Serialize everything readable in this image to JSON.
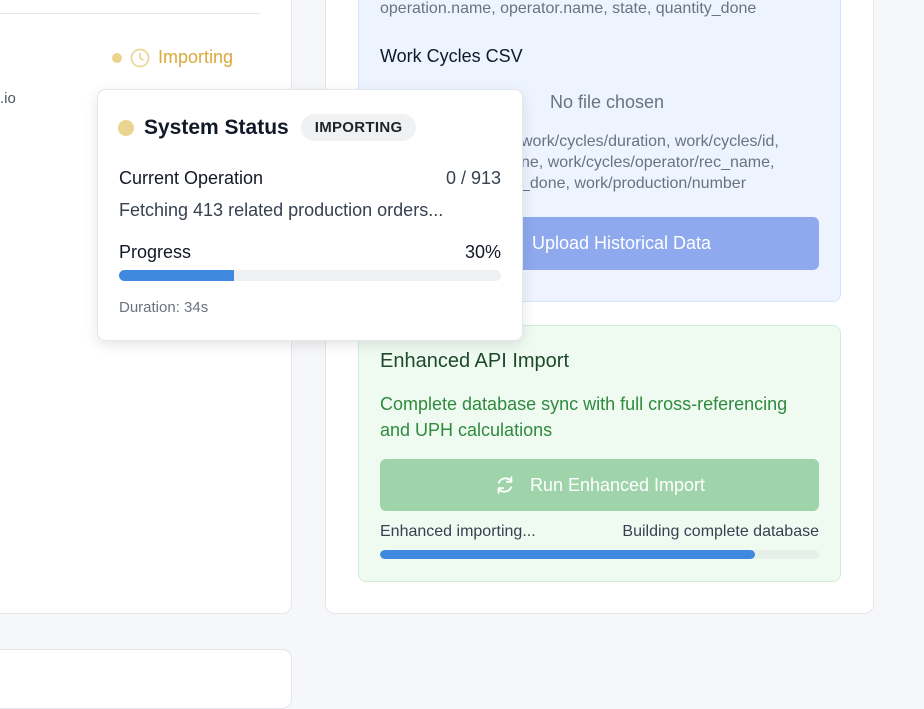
{
  "left_card": {
    "status_label": "Importing",
    "snippet": ".io"
  },
  "blue_panel": {
    "fields_line": "operation.name, operator.name, state, quantity_done",
    "work_cycles_title": "Work Cycles CSV",
    "file_chosen": "No file chosen",
    "wc_fields_1": "work/cycles/duration, work/cycles/id,",
    "wc_fields_2": "ne, work/cycles/operator/rec_name,",
    "wc_fields_3": "_done, work/production/number",
    "upload_label": "Upload Historical Data"
  },
  "green_panel": {
    "title": "Enhanced API Import",
    "description": "Complete database sync with full cross-referencing and UPH calculations",
    "run_label": "Run Enhanced Import",
    "status_text": "Enhanced importing...",
    "sub_status": "Building complete database",
    "progress_fraction": 0.855
  },
  "popover": {
    "title": "System Status",
    "badge": "IMPORTING",
    "current_operation_label": "Current Operation",
    "current_operation_value": "0 / 913",
    "fetching_text": "Fetching 413 related production orders...",
    "progress_label": "Progress",
    "progress_value": "30%",
    "progress_fraction": 0.3,
    "duration": "Duration: 34s"
  },
  "colors": {
    "importing_yellow": "#d9a93a",
    "status_dot": "#ebd48e",
    "progress_blue": "#3f8ae0",
    "upload_button": "#8fa9ef",
    "run_button": "#9fd3a9"
  },
  "icons": [
    "clock-icon",
    "refresh-icon",
    "status-dot-icon"
  ]
}
